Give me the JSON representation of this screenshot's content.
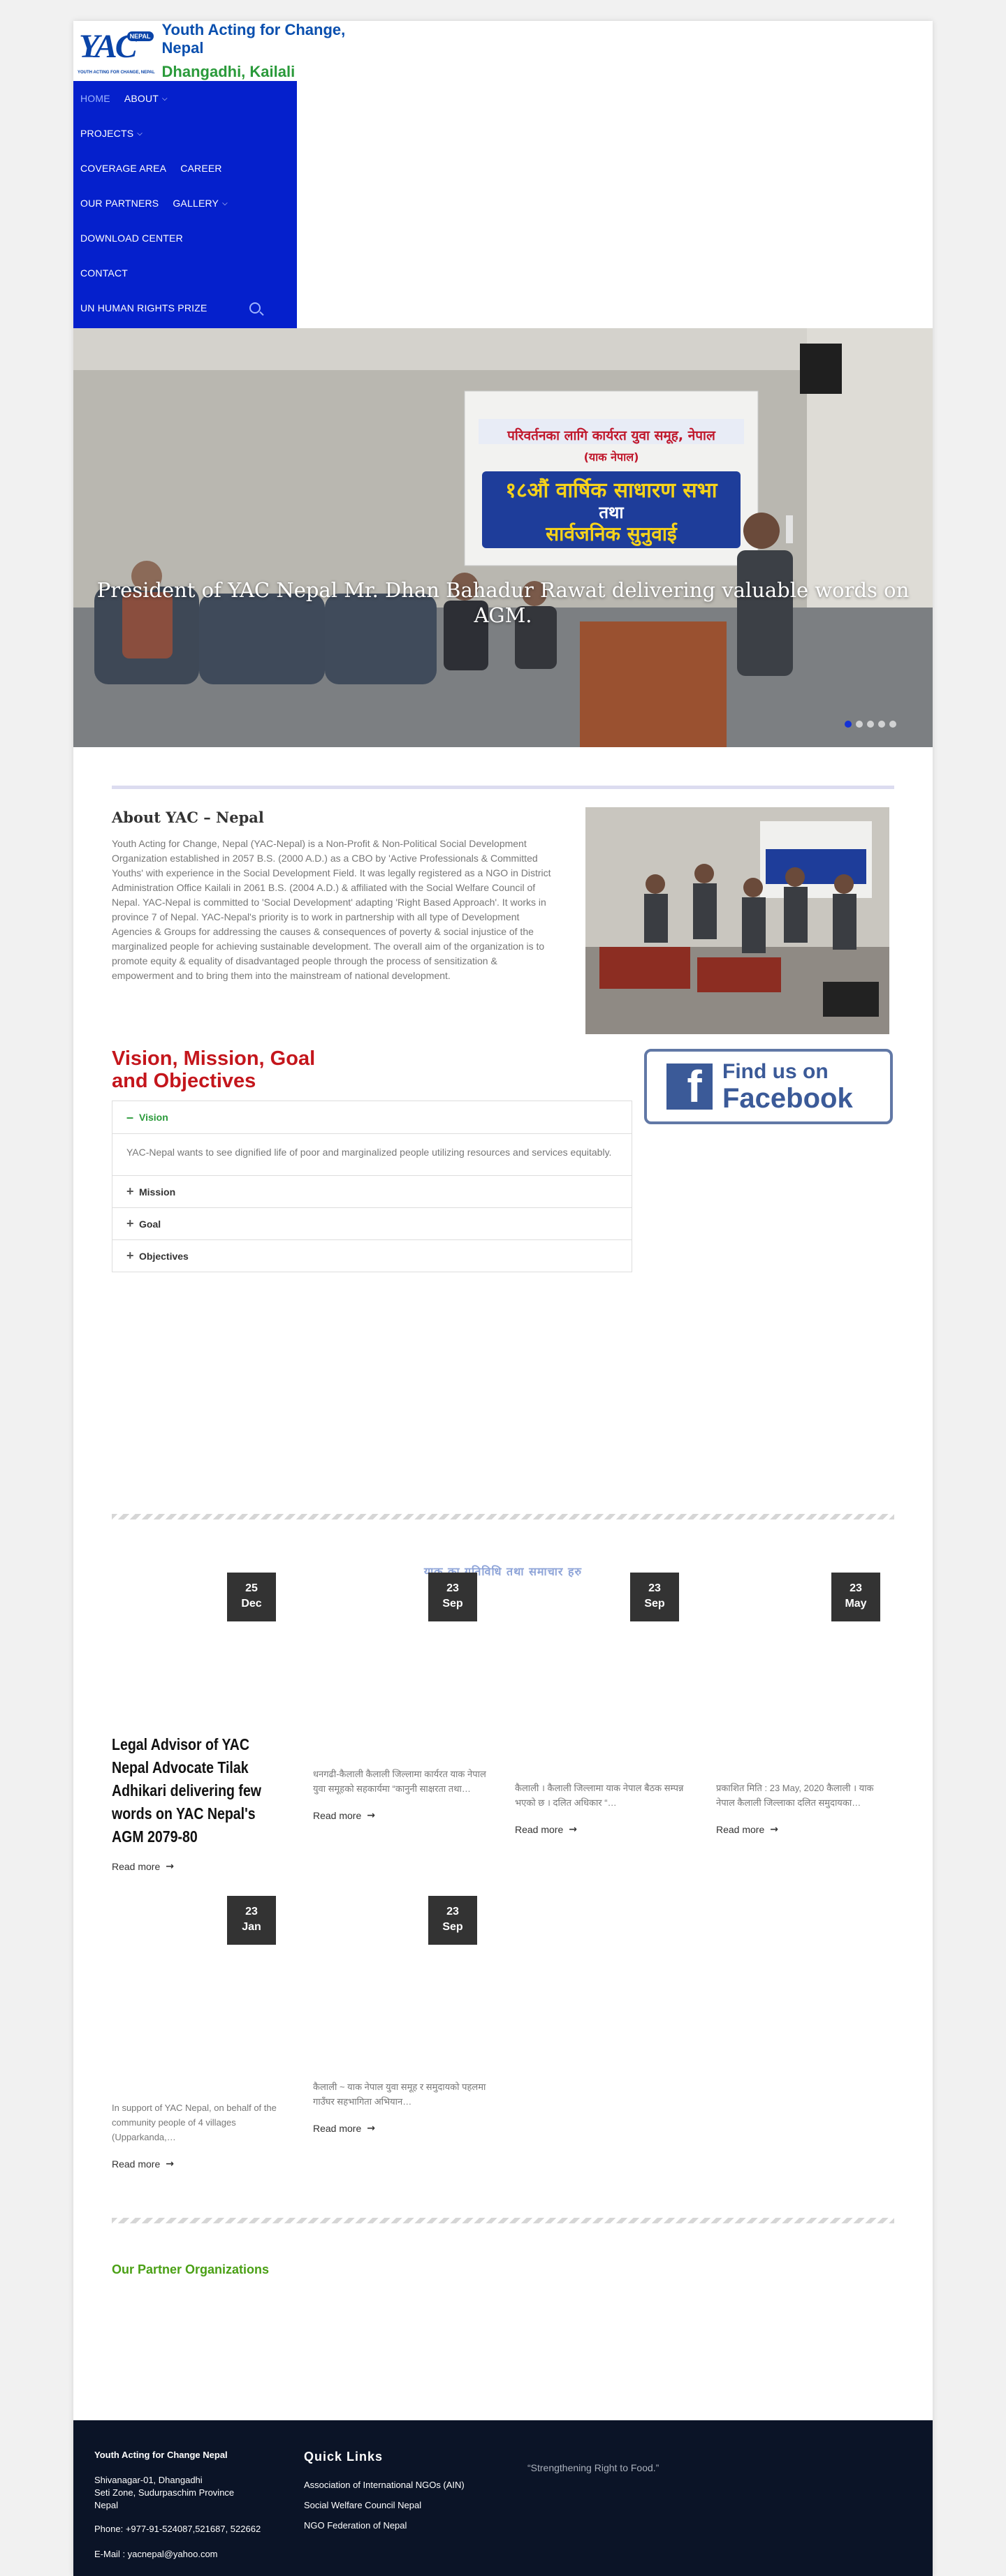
{
  "header": {
    "brand_logo_text": "YAC",
    "brand_logo_badge": "NEPAL",
    "brand_logo_tagline": "YOUTH ACTING FOR CHANGE, NEPAL",
    "brand_title": "Youth Acting for Change, Nepal",
    "brand_subtitle": "Dhangadhi, Kailali"
  },
  "nav": {
    "items": [
      {
        "label": "HOME",
        "dropdown": false
      },
      {
        "label": "ABOUT",
        "dropdown": true
      },
      {
        "label": "PROJECTS",
        "dropdown": true
      },
      {
        "label": "COVERAGE AREA",
        "dropdown": false
      },
      {
        "label": "CAREER",
        "dropdown": false
      },
      {
        "label": "OUR PARTNERS",
        "dropdown": false
      },
      {
        "label": "GALLERY",
        "dropdown": true
      },
      {
        "label": "DOWNLOAD CENTER",
        "dropdown": false
      },
      {
        "label": "CONTACT",
        "dropdown": false
      },
      {
        "label": "UN HUMAN RIGHTS PRIZE",
        "dropdown": false
      }
    ],
    "search_icon": "search-icon"
  },
  "slider": {
    "banner_line1": "परिवर्तनका लागि कार्यरत युवा समूह, नेपाल",
    "banner_line2": "(याक नेपाल)",
    "banner_line3": "१८औं वार्षिक साधारण सभा",
    "banner_line4": "तथा",
    "banner_line5": "सार्वजनिक सुनुवाई",
    "caption": "President of YAC Nepal Mr. Dhan Bahadur Rawat delivering valuable words on AGM.",
    "dots": 5,
    "active_dot": 0
  },
  "about": {
    "title": "About YAC – Nepal",
    "text": "Youth Acting for Change, Nepal (YAC-Nepal) is a Non-Profit & Non-Political Social Development Organization established in 2057 B.S. (2000 A.D.) as a CBO by 'Active Professionals & Committed Youths' with experience in the Social Development Field. It was legally registered as a NGO in District Administration Office Kailali in 2061 B.S. (2004 A.D.) & affiliated with the Social Welfare Council of Nepal. YAC-Nepal is committed to 'Social Development' adapting 'Right Based Approach'. It works in province 7 of Nepal. YAC-Nepal's priority is to work in partnership with all type of Development Agencies & Groups for addressing the causes & consequences of poverty & social injustice of the marginalized people for achieving sustainable development. The overall aim of the organization is to promote equity & equality of disadvantaged people through the process of sensitization & empowerment and to bring them into the mainstream of national development."
  },
  "vmg": {
    "title": "Vision, Mission, Goal and Objectives",
    "items": [
      {
        "label": "Vision",
        "open": true,
        "body": "YAC-Nepal wants to see dignified life of poor and marginalized people utilizing resources and services equitably."
      },
      {
        "label": "Mission",
        "open": false
      },
      {
        "label": "Goal",
        "open": false
      },
      {
        "label": "Objectives",
        "open": false
      }
    ]
  },
  "facebook": {
    "line1": "Find us on",
    "line2": "Facebook"
  },
  "news": {
    "heading": "याक् का गतिविधि तथा समाचार हरु",
    "read_more": "Read more",
    "cards": [
      {
        "day": "25",
        "month": "Dec",
        "title": "Legal Advisor of YAC Nepal Advocate Tilak Adhikari delivering few words on YAC Nepal's AGM 2079-80",
        "excerpt": ""
      },
      {
        "day": "23",
        "month": "Sep",
        "title": "",
        "excerpt": "धनगढी-कैलाली कैलाली जिल्लामा कार्यरत याक नेपाल युवा समूहको सहकार्यमा “कानुनी साक्षरता तथा…"
      },
      {
        "day": "23",
        "month": "Sep",
        "title": "",
        "excerpt": "कैलाली । कैलाली जिल्लामा याक नेपाल बैठक सम्पन्न भएको छ । दलित अधिकार “…"
      },
      {
        "day": "23",
        "month": "May",
        "title": "",
        "excerpt": "प्रकाशित मिति : 23 May, 2020 कैलाली । याक नेपाल कैलाली जिल्लाका दलित समुदायका…"
      },
      {
        "day": "23",
        "month": "Jan",
        "title": "",
        "excerpt": "In support of YAC Nepal, on behalf of the community people of 4 villages (Upparkanda,…"
      },
      {
        "day": "23",
        "month": "Sep",
        "title": "",
        "excerpt": "कैलाली ~ याक नेपाल युवा समूह र समुदायको पहलमा गाउँघर सहभागिता अभियान…"
      }
    ]
  },
  "partners": {
    "title": "Our Partner Organizations"
  },
  "footer": {
    "org_name": "Youth Acting for Change Nepal",
    "address1": "Shivanagar-01, Dhangadhi",
    "address2": "Seti Zone, Sudurpaschim Province",
    "address3": "Nepal",
    "phone": "Phone: +977-91-524087,521687, 522662",
    "email": "E-Mail : yacnepal@yahoo.com",
    "quick_links_title": "Quick Links",
    "links": [
      "Association of International NGOs (AIN)",
      "Social Welfare Council Nepal",
      "NGO Federation of Nepal"
    ],
    "quote": "“Strengthening Right to Food.”"
  },
  "colors": {
    "nav_bg": "#0520cc",
    "accent_red": "#c4161c",
    "accent_green": "#2a9a3a",
    "footer_bg": "#0b1427"
  }
}
